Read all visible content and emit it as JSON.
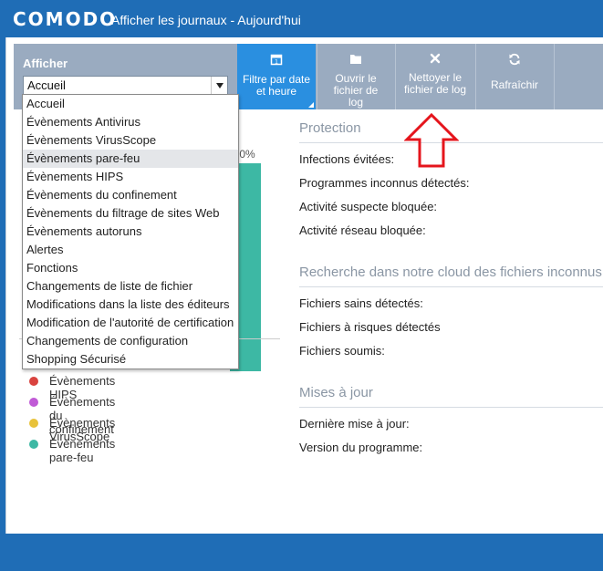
{
  "app": {
    "logo": "COMODO",
    "title": "Afficher les journaux - Aujourd'hui"
  },
  "toolbar": {
    "afficher_label": "Afficher",
    "select_value": "Accueil",
    "buttons": [
      {
        "label": "Filtre par date et heure",
        "icon": "calendar-icon"
      },
      {
        "label": "Ouvrir le fichier de log",
        "icon": "folder-icon"
      },
      {
        "label": "Nettoyer le fichier de log",
        "icon": "close-icon"
      },
      {
        "label": "Rafraîchir",
        "icon": "refresh-icon"
      }
    ]
  },
  "dropdown": {
    "items": [
      "Accueil",
      "Évènements Antivirus",
      "Évènements VirusScope",
      "Évènements pare-feu",
      "Évènements HIPS",
      "Évènements du confinement",
      "Évènements du filtrage de sites Web",
      "Évènements autoruns",
      "Alertes",
      "Fonctions",
      "Changements de liste de fichier",
      "Modifications dans la liste des éditeurs",
      "Modification de l'autorité de certification",
      "Changements de configuration",
      "Shopping Sécurisé"
    ],
    "highlighted_index": 3
  },
  "chart": {
    "pct_label": ".0%",
    "bar_color": "#3db8a4"
  },
  "legend": [
    {
      "label": "Évènements HIPS",
      "color": "#d9433f"
    },
    {
      "label": "Évènements du confinement",
      "color": "#c05ad6"
    },
    {
      "label": "Évènements VirusScope",
      "color": "#e8c23a"
    },
    {
      "label": "Évènements pare-feu",
      "color": "#3db8a4"
    }
  ],
  "protection": {
    "title": "Protection",
    "rows": [
      "Infections évitées:",
      "Programmes inconnus détectés:",
      "Activité suspecte bloquée:",
      "Activité réseau bloquée:"
    ]
  },
  "cloud": {
    "title": "Recherche dans notre cloud des fichiers inconnus",
    "rows": [
      "Fichiers sains détectés:",
      "Fichiers à risques détectés",
      "Fichiers soumis:"
    ]
  },
  "updates": {
    "title": "Mises à jour",
    "rows": [
      "Dernière mise à jour:",
      "Version du programme:"
    ]
  },
  "colors": {
    "accent": "#2a8fe0",
    "titlebar": "#1f6db6",
    "arrow": "#e5151c"
  }
}
